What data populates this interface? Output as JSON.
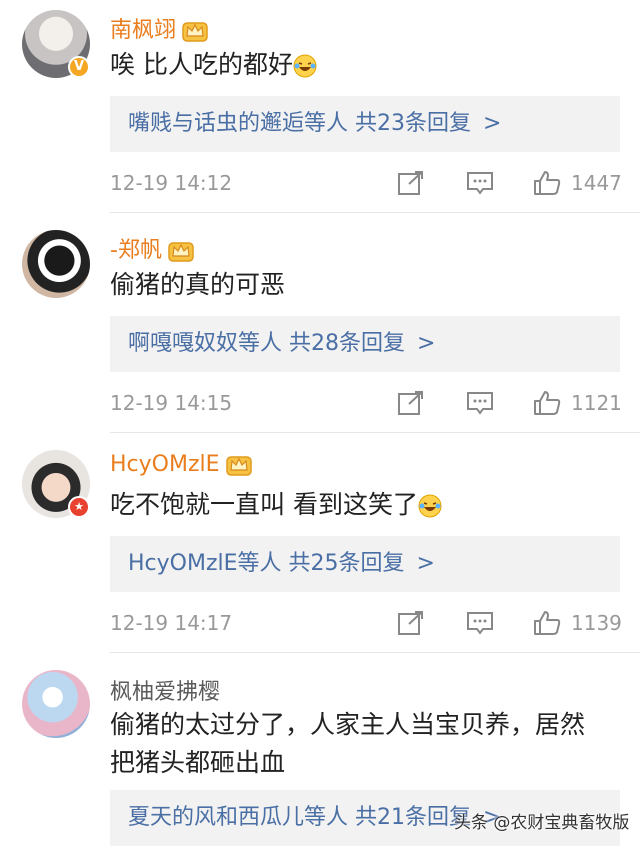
{
  "comments": [
    {
      "username": "南枫翊",
      "text": "唉 比人吃的都好",
      "replies_users": "嘴贱与话虫的邂逅等人",
      "replies_count": "共23条回复",
      "time": "12-19 14:12",
      "likes": "1447"
    },
    {
      "username": "-郑帆",
      "text": "偷猪的真的可恶",
      "replies_users": "啊嘎嘎奴奴等人",
      "replies_count": "共28条回复",
      "time": "12-19 14:15",
      "likes": "1121"
    },
    {
      "username": "HcyOMzlE",
      "text": "吃不饱就一直叫 看到这笑了",
      "replies_users": "HcyOMzlE等人",
      "replies_count": "共25条回复",
      "time": "12-19 14:17",
      "likes": "1139"
    },
    {
      "username": "枫柚爱拂樱",
      "text_line1": "偷猪的太过分了，人家主人当宝贝养，居然",
      "text_line2": "把猪头都砸出血",
      "replies_users": "夏天的风和西瓜儿等人",
      "replies_count": "共21条回复"
    }
  ],
  "chevron": ">",
  "watermark": "头条 @农财宝典畜牧版",
  "colors": {
    "username_vip": "#ea7e1f",
    "link_blue": "#4a6fa5",
    "meta_gray": "#999999"
  },
  "icons": [
    "crown-icon",
    "share-icon",
    "comment-icon",
    "like-icon",
    "laugh-cry-emoji"
  ]
}
